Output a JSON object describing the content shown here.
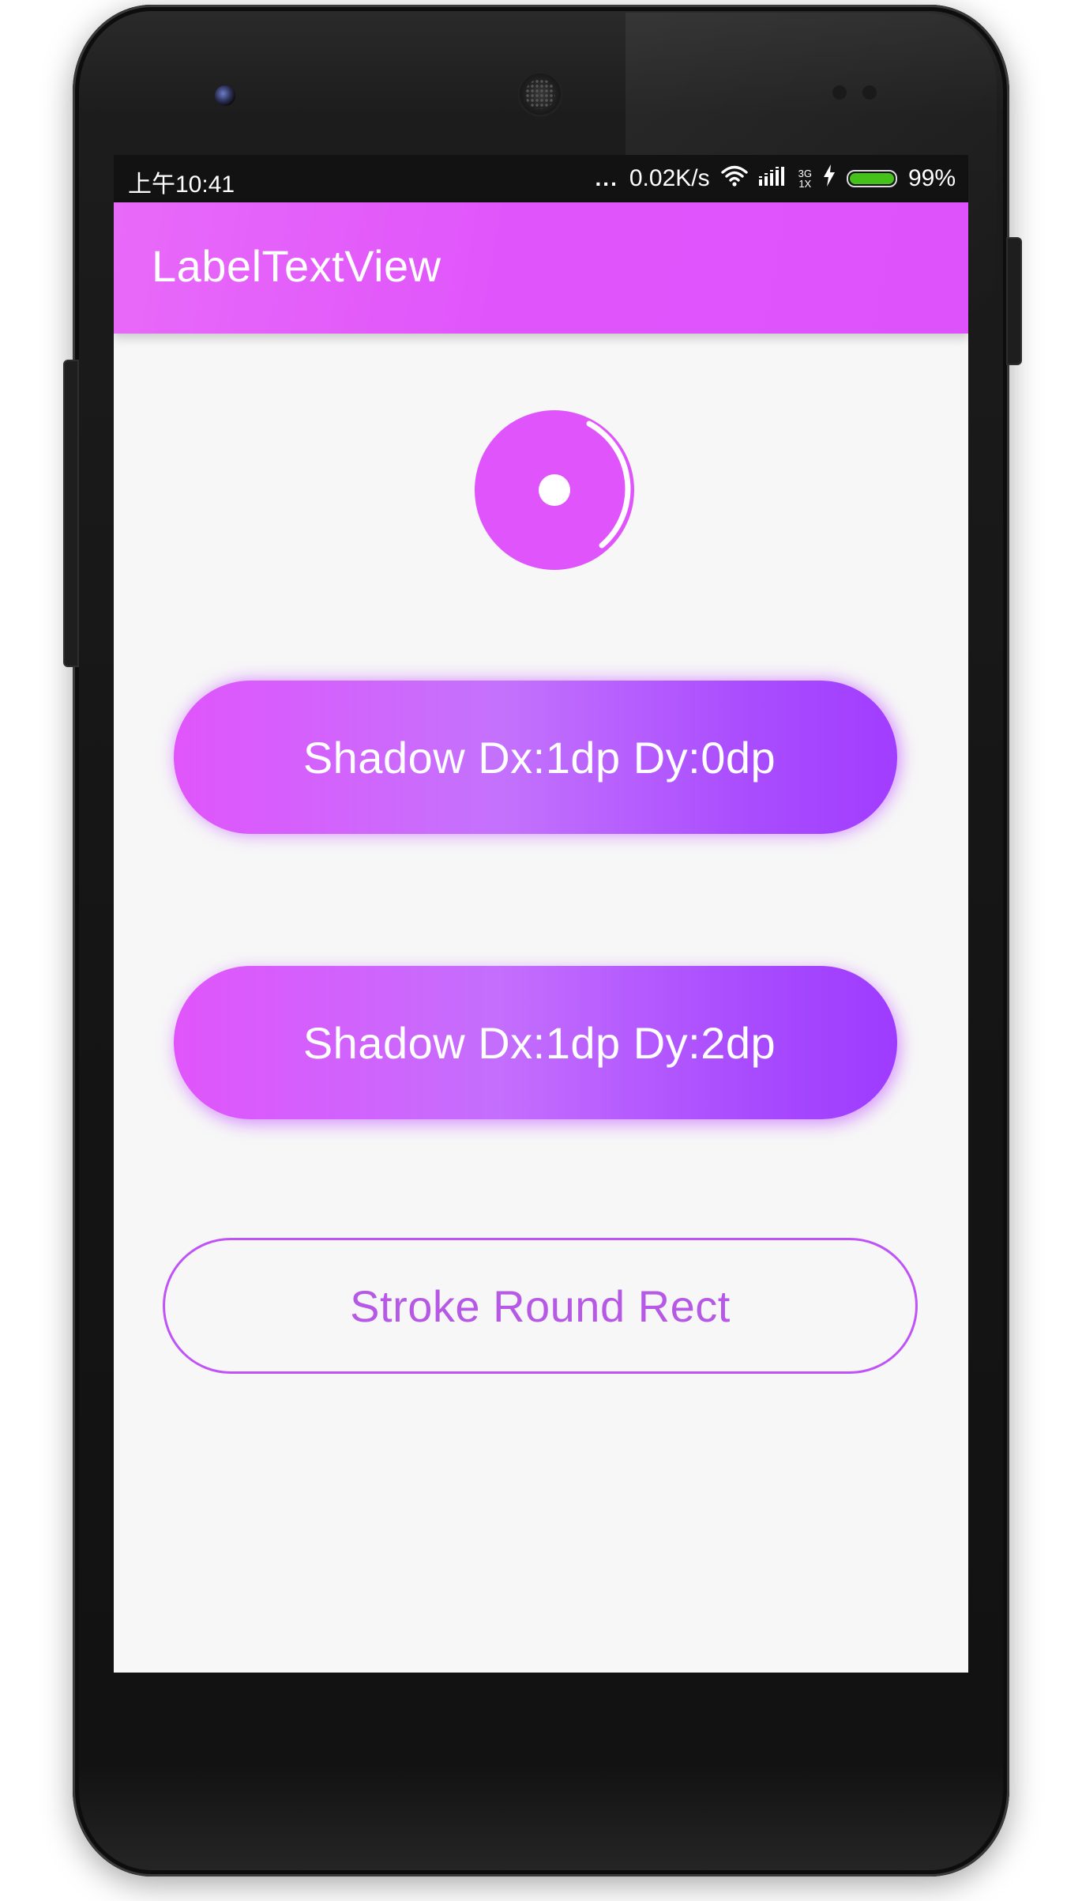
{
  "status_bar": {
    "time": "上午10:41",
    "more": "...",
    "network_speed": "0.02K/s",
    "network_type_top": "3G",
    "network_type_bottom": "1X",
    "battery_percent": "99%",
    "battery_level": 0.99,
    "wifi_icon": "wifi-icon",
    "signal_icon": "signal-bars-icon",
    "charging_icon": "lightning-icon",
    "battery_color": "#45c21a"
  },
  "app_bar": {
    "title": "LabelTextView",
    "color": "#e055fb"
  },
  "main": {
    "logo_icon": "disc-logo-icon",
    "buttons": [
      {
        "label": "Shadow Dx:1dp Dy:0dp"
      },
      {
        "label": "Shadow Dx:1dp Dy:2dp"
      },
      {
        "label": "Stroke Round Rect"
      }
    ],
    "gradient_start": "#e055fb",
    "gradient_end": "#a13dff",
    "stroke_color": "#c053f5"
  }
}
